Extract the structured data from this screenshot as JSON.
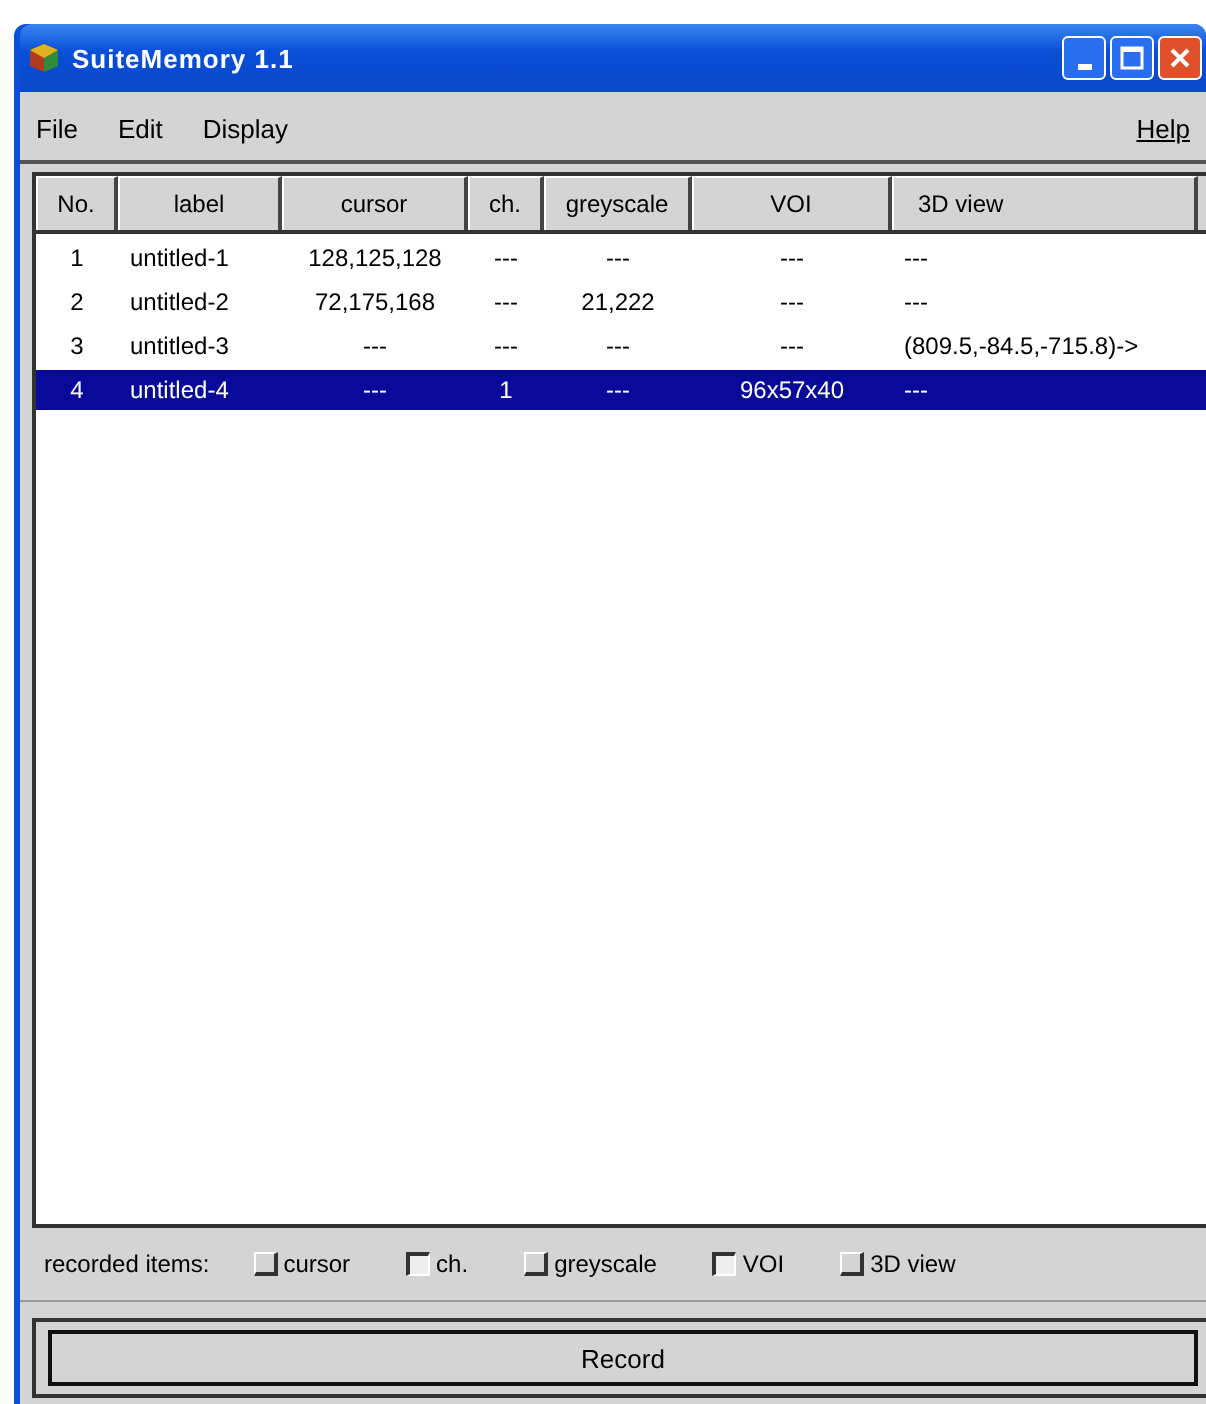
{
  "window": {
    "title": "SuiteMemory 1.1"
  },
  "menu": {
    "left": [
      "File",
      "Edit",
      "Display"
    ],
    "right": [
      "Help"
    ]
  },
  "table": {
    "columns": [
      "No.",
      "label",
      "cursor",
      "ch.",
      "greyscale",
      "VOI",
      "3D view"
    ],
    "rows": [
      {
        "cells": [
          "1",
          "untitled-1",
          "128,125,128",
          "---",
          "---",
          "---",
          "---"
        ],
        "selected": false
      },
      {
        "cells": [
          "2",
          "untitled-2",
          "72,175,168",
          "---",
          "21,222",
          "---",
          "---"
        ],
        "selected": false
      },
      {
        "cells": [
          "3",
          "untitled-3",
          "---",
          "---",
          "---",
          "---",
          "(809.5,-84.5,-715.8)->"
        ],
        "selected": false
      },
      {
        "cells": [
          "4",
          "untitled-4",
          "---",
          "1",
          "---",
          "96x57x40",
          "---"
        ],
        "selected": true
      }
    ]
  },
  "recorded_items": {
    "label": "recorded items:",
    "options": [
      {
        "label": "cursor",
        "checked": false
      },
      {
        "label": "ch.",
        "checked": true
      },
      {
        "label": "greyscale",
        "checked": false
      },
      {
        "label": "VOI",
        "checked": true
      },
      {
        "label": "3D view",
        "checked": false
      }
    ]
  },
  "buttons": [
    "Record"
  ]
}
